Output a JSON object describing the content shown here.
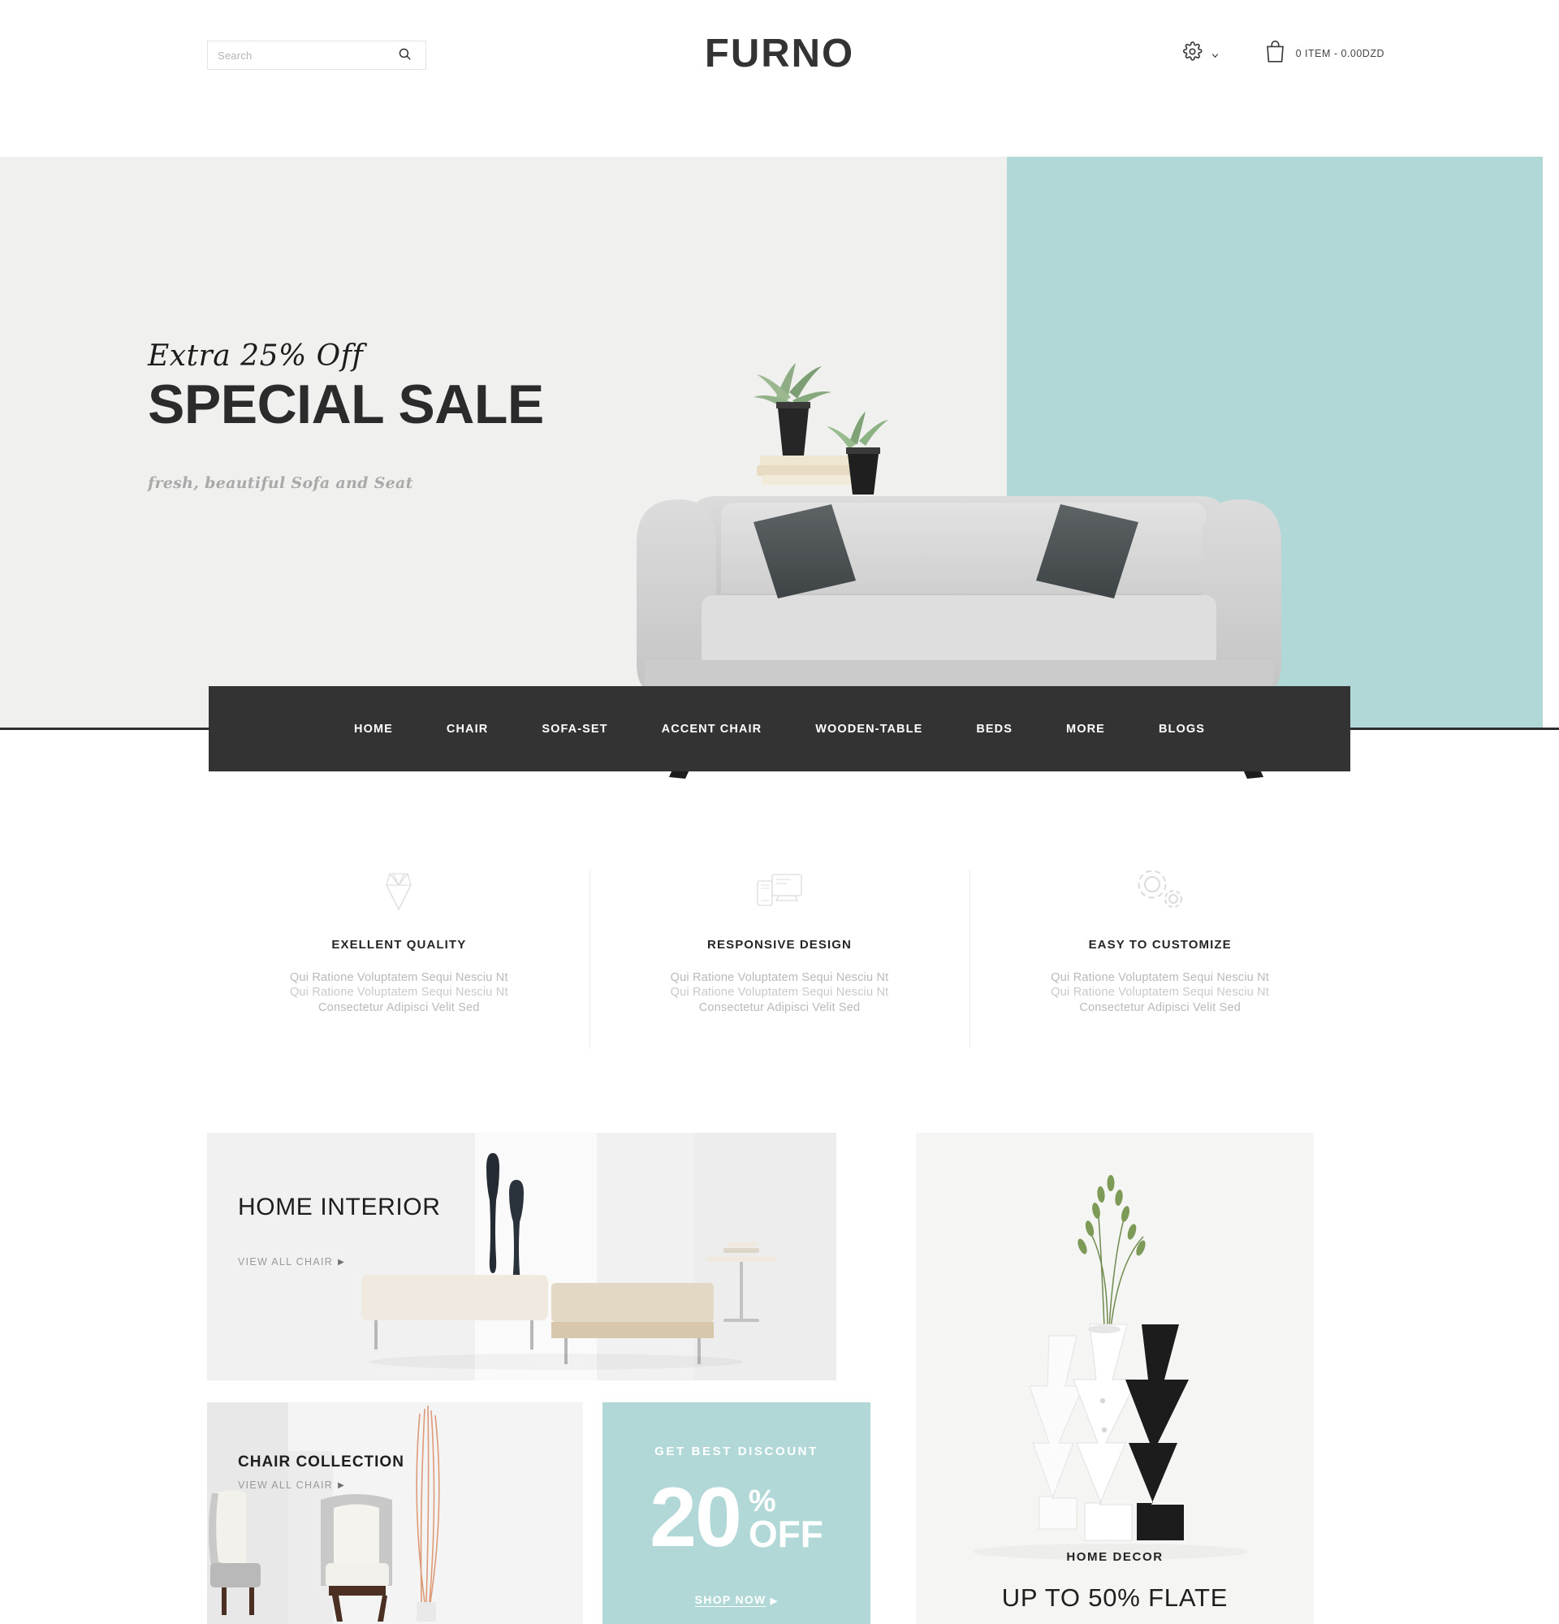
{
  "header": {
    "logo": "FURNO",
    "search": {
      "placeholder": "Search",
      "value": "",
      "icon": "search-icon"
    },
    "settings": {
      "icon": "gear-icon",
      "chevron": "chevron-down-icon"
    },
    "cart": {
      "icon": "shopping-bag-icon",
      "text": "0 ITEM - 0.00DZD"
    }
  },
  "hero": {
    "script_line": "Extra 25% Off",
    "title": "SPECIAL SALE",
    "subtitle": "fresh, beautiful Sofa and Seat",
    "left_bg": "#f0f0ef",
    "right_bg": "#b1d8d7"
  },
  "nav": {
    "bg": "#333333",
    "items": [
      {
        "label": "HOME"
      },
      {
        "label": "CHAIR"
      },
      {
        "label": "SOFA-SET"
      },
      {
        "label": "ACCENT CHAIR"
      },
      {
        "label": "WOODEN-TABLE"
      },
      {
        "label": "BEDS"
      },
      {
        "label": "MORE"
      },
      {
        "label": "BLOGS"
      }
    ]
  },
  "features": [
    {
      "icon": "diamond-icon",
      "title": "EXELLENT QUALITY",
      "line1": "Qui Ratione Voluptatem Sequi Nesciu Nt",
      "line2": "Qui Ratione Voluptatem Sequi Nesciu Nt",
      "line3": "Consectetur Adipisci Velit Sed"
    },
    {
      "icon": "responsive-devices-icon",
      "title": "RESPONSIVE DESIGN",
      "line1": "Qui Ratione Voluptatem Sequi Nesciu Nt",
      "line2": "Qui Ratione Voluptatem Sequi Nesciu Nt",
      "line3": "Consectetur Adipisci Velit Sed"
    },
    {
      "icon": "gears-icon",
      "title": "EASY TO CUSTOMIZE",
      "line1": "Qui Ratione Voluptatem Sequi Nesciu Nt",
      "line2": "Qui Ratione Voluptatem Sequi Nesciu Nt",
      "line3": "Consectetur Adipisci Velit Sed"
    }
  ],
  "promos": {
    "home_interior": {
      "title": "HOME INTERIOR",
      "link": "VIEW ALL CHAIR",
      "arrow": "▶"
    },
    "chair_collection": {
      "title": "CHAIR COLLECTION",
      "link": "VIEW ALL CHAIR",
      "arrow": "▶"
    },
    "discount": {
      "heading": "GET BEST DISCOUNT",
      "number": "20",
      "percent": "%",
      "off": "OFF",
      "cta": "SHOP NOW",
      "arrow": "▶",
      "bg": "#b1d8d7"
    },
    "home_decor": {
      "title": "HOME DECOR",
      "subtitle": "UP TO 50% FLATE"
    }
  }
}
